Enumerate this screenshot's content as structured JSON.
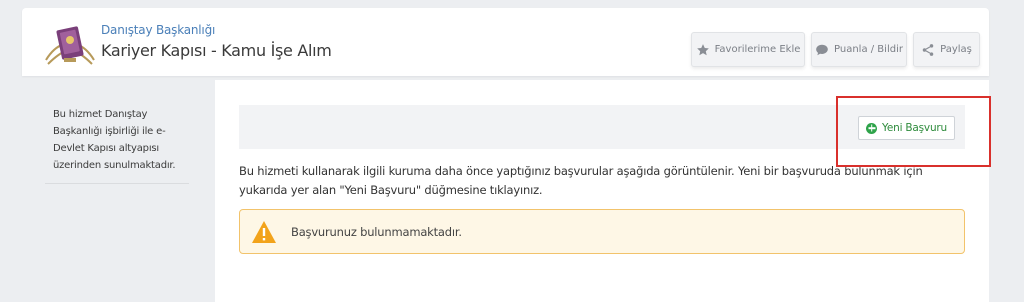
{
  "header": {
    "agency": "Danıştay Başkanlığı",
    "title": "Kariyer Kapısı - Kamu İşe Alım",
    "actions": {
      "favorite": "Favorilerime Ekle",
      "rate": "Puanla / Bildir",
      "share": "Paylaş"
    }
  },
  "sidebar": {
    "info": "Bu hizmet Danıştay Başkanlığı işbirliği ile e-Devlet Kapısı altyapısı üzerinden sunulmaktadır."
  },
  "main": {
    "new_application_label": "Yeni Başvuru",
    "description": "Bu hizmeti kullanarak ilgili kuruma daha önce yaptığınız başvurular aşağıda görüntülenir. Yeni bir başvuruda bulunmak için yukarıda yer alan \"Yeni Başvuru\" düğmesine tıklayınız.",
    "alert": "Başvurunuz bulunmamaktadır."
  },
  "colors": {
    "highlight": "#d9302c",
    "agency_link": "#4a7fb8",
    "success": "#2ea34a",
    "warning": "#f2a31b"
  },
  "icons": {
    "logo": "danistay-logo",
    "favorite": "star-icon",
    "rate": "speech-bubble-icon",
    "share": "share-icon",
    "new_application": "plus-circle-icon",
    "alert": "warning-triangle-icon"
  }
}
